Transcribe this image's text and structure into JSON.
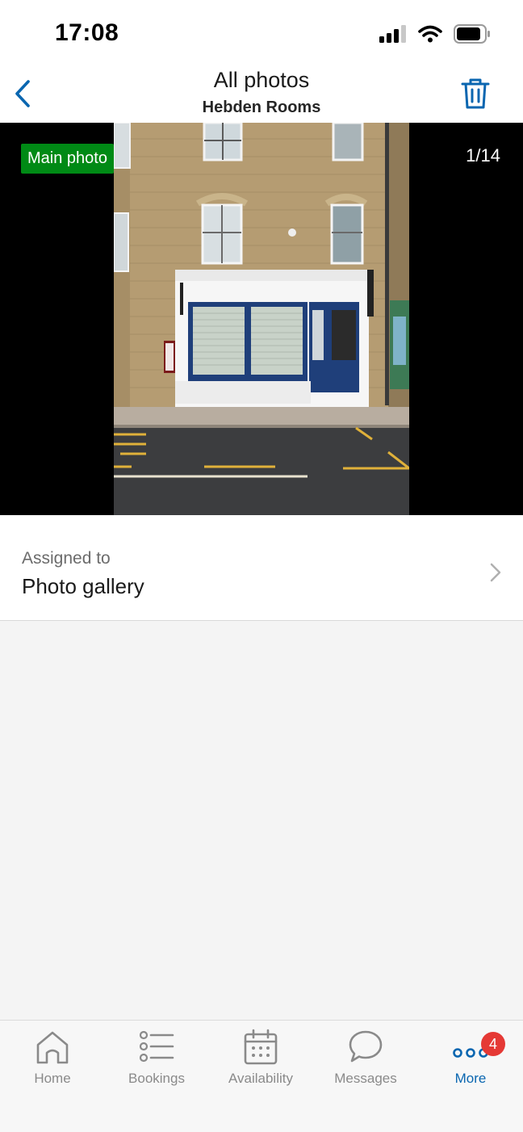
{
  "status_bar": {
    "time": "17:08"
  },
  "header": {
    "title": "All photos",
    "subtitle": "Hebden Rooms"
  },
  "viewer": {
    "main_badge": "Main photo",
    "counter": "1/14"
  },
  "assigned": {
    "label": "Assigned to",
    "value": "Photo gallery"
  },
  "tabs": [
    {
      "label": "Home",
      "icon": "home-icon"
    },
    {
      "label": "Bookings",
      "icon": "list-icon"
    },
    {
      "label": "Availability",
      "icon": "calendar-icon"
    },
    {
      "label": "Messages",
      "icon": "chat-icon"
    },
    {
      "label": "More",
      "icon": "more-icon",
      "badge": "4"
    }
  ],
  "colors": {
    "accent": "#0a66b0",
    "badge_green": "#008a15",
    "notification_red": "#e53935"
  }
}
